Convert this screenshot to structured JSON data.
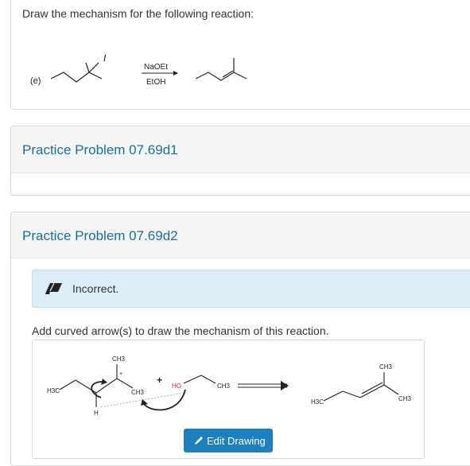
{
  "top_card": {
    "prompt": "Draw the mechanism for the following reaction:",
    "part_label": "(e)",
    "leaving_group": "I",
    "reagent": "NaOEt",
    "solvent": "EtOH"
  },
  "problems": [
    {
      "title": "Practice Problem 07.69d1"
    },
    {
      "title": "Practice Problem 07.69d2"
    }
  ],
  "alert": {
    "icon": "eraser-icon",
    "text": "Incorrect."
  },
  "question": {
    "prompt": "Add curved arrow(s) to draw the mechanism of this reaction."
  },
  "scheme": {
    "reactant_ch3_top": "CH3",
    "reactant_h3c": "H3C",
    "reactant_ch3_right": "CH3",
    "reactant_h": "H",
    "plus": "+",
    "base": "HO",
    "byproduct_ch3": "CH3",
    "product_ch3_top": "CH3",
    "product_h3c": "H3C",
    "product_ch3_right": "CH3"
  },
  "edit_button": {
    "label": "Edit Drawing",
    "icon": "pencil-icon"
  },
  "colors": {
    "title_blue": "#1b6f9f",
    "alert_bg": "#dcedf7",
    "button_blue": "#1e7fbd",
    "base_red": "#d9261c"
  }
}
